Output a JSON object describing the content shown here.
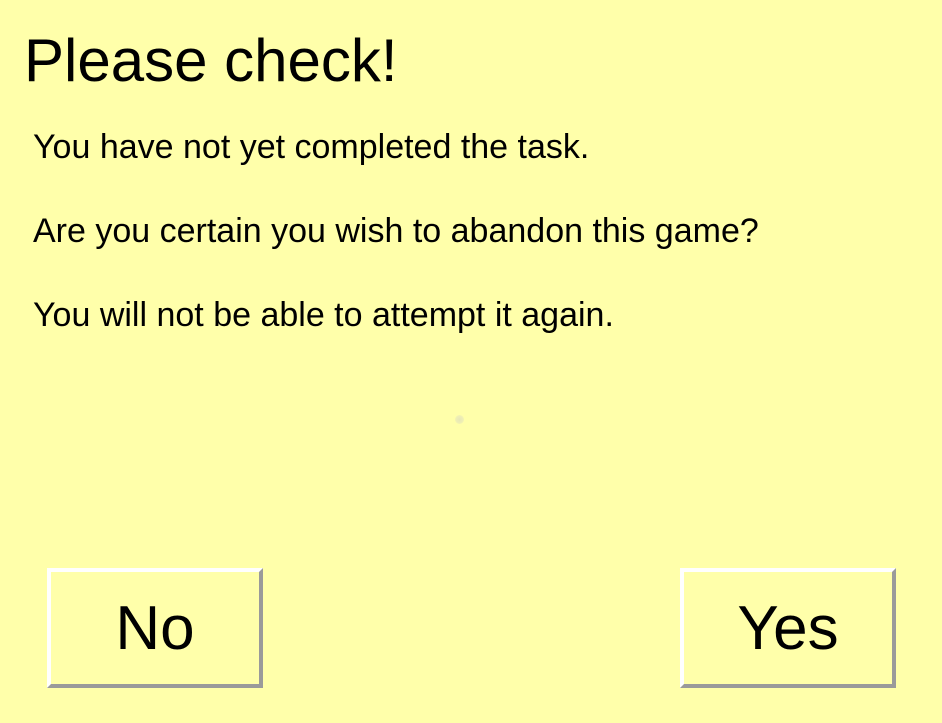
{
  "dialog": {
    "title": "Please check!",
    "messages": [
      "You have not yet completed the task.",
      "Are you certain you wish to abandon this game?",
      "You will not be able to attempt it again."
    ],
    "buttons": {
      "no_label": "No",
      "yes_label": "Yes"
    }
  },
  "colors": {
    "background": "#ffffaa",
    "text": "#000000",
    "button_highlight": "#ffffff",
    "button_shadow": "#9a9a9a"
  }
}
